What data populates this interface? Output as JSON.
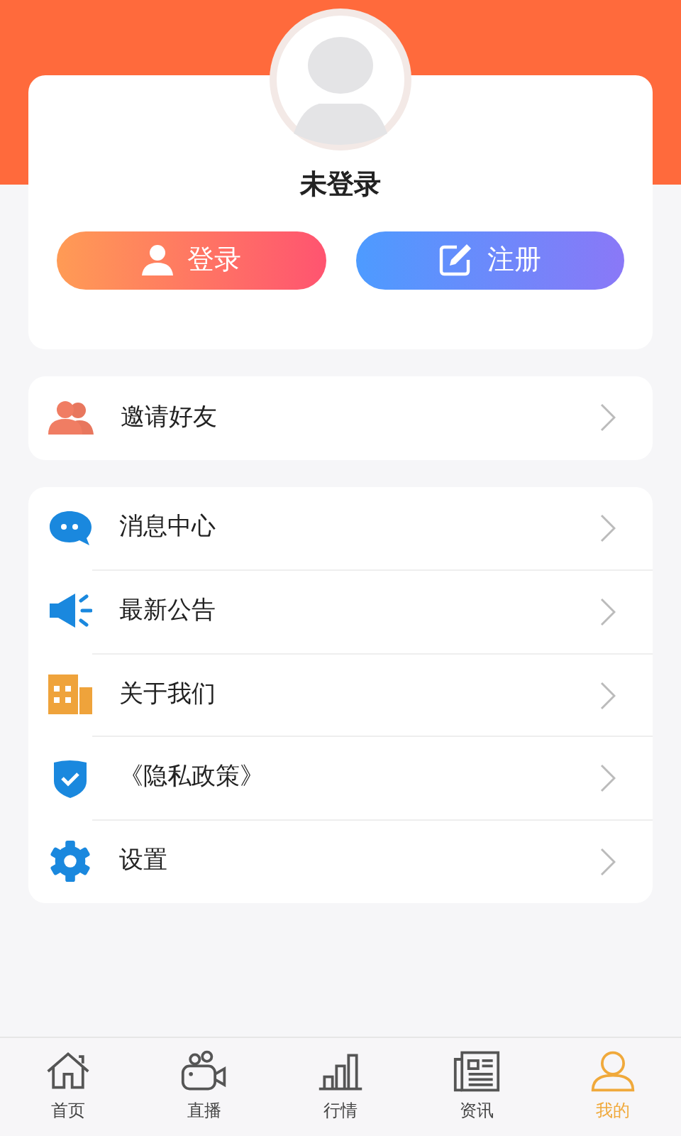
{
  "profile": {
    "name": "未登录"
  },
  "actions": [
    {
      "kind": "login",
      "label": "登录"
    },
    {
      "kind": "register",
      "label": "注册"
    }
  ],
  "groups": [
    [
      {
        "kind": "invite",
        "label": "邀请好友"
      }
    ],
    [
      {
        "kind": "message",
        "label": "消息中心"
      },
      {
        "kind": "notice",
        "label": "最新公告"
      },
      {
        "kind": "about",
        "label": "关于我们"
      },
      {
        "kind": "privacy",
        "label": "《隐私政策》"
      },
      {
        "kind": "settings",
        "label": "设置"
      }
    ]
  ],
  "tabs": [
    {
      "kind": "home",
      "label": "首页",
      "selected": false
    },
    {
      "kind": "live",
      "label": "直播",
      "selected": false
    },
    {
      "kind": "market",
      "label": "行情",
      "selected": false
    },
    {
      "kind": "news",
      "label": "资讯",
      "selected": false
    },
    {
      "kind": "me",
      "label": "我的",
      "selected": true
    }
  ]
}
